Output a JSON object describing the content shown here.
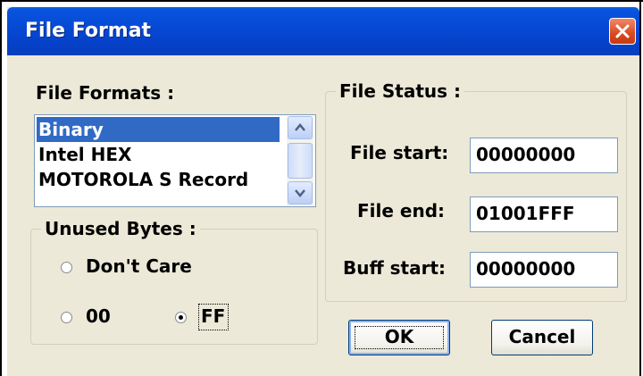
{
  "window": {
    "title": "File Format"
  },
  "formats": {
    "label": "File Formats :",
    "items": [
      "Binary",
      "Intel HEX",
      "MOTOROLA S Record"
    ],
    "selected": "Binary"
  },
  "unused_bytes": {
    "label": "Unused Bytes :",
    "options": [
      "Don't Care",
      "00",
      "FF"
    ],
    "selected": "FF"
  },
  "file_status": {
    "label": "File Status :",
    "file_start_label": "File start:",
    "file_start_value": "00000000",
    "file_end_label": "File end:",
    "file_end_value": "01001FFF",
    "buff_start_label": "Buff start:",
    "buff_start_value": "00000000"
  },
  "buttons": {
    "ok": "OK",
    "cancel": "Cancel"
  },
  "icons": {
    "close": "close-icon",
    "scroll_up": "chevron-up-icon",
    "scroll_down": "chevron-down-icon"
  }
}
